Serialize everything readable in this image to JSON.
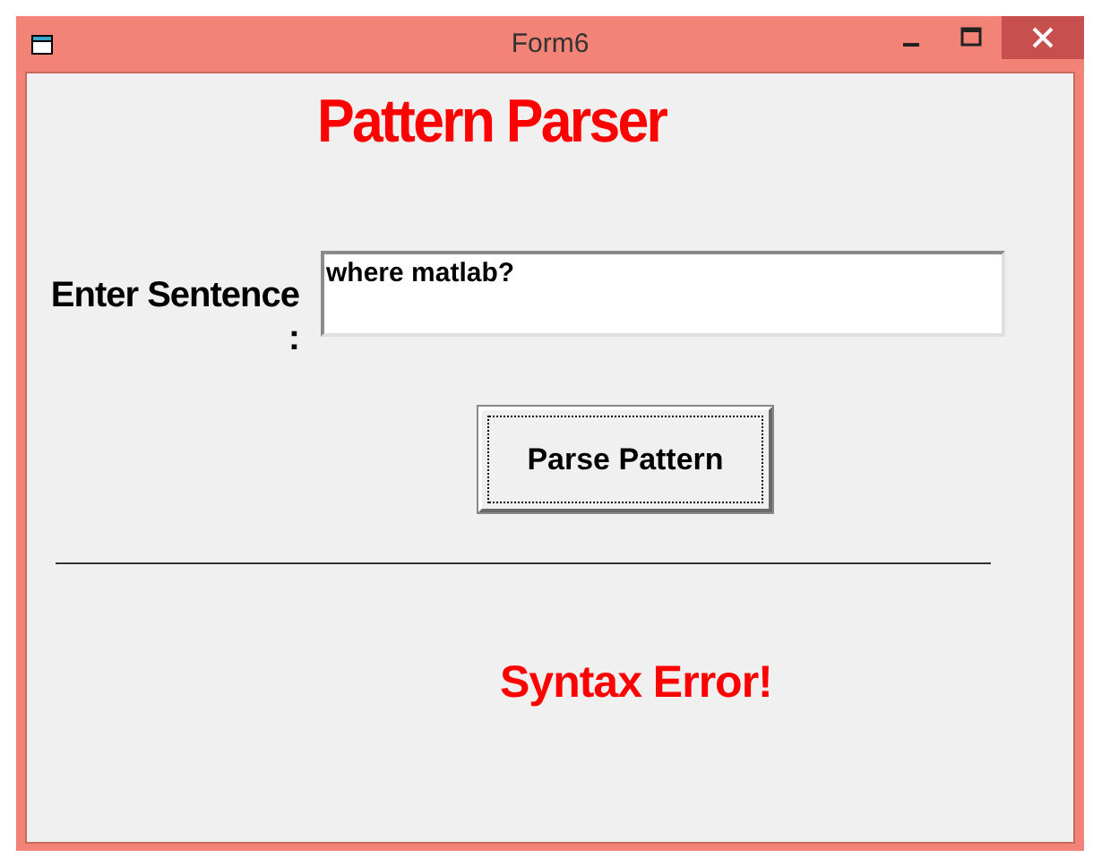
{
  "window": {
    "title": "Form6"
  },
  "heading": "Pattern Parser",
  "sentence": {
    "label": "Enter Sentence :",
    "value": "where matlab?"
  },
  "parse_button": "Parse Pattern",
  "result": "Syntax Error!"
}
